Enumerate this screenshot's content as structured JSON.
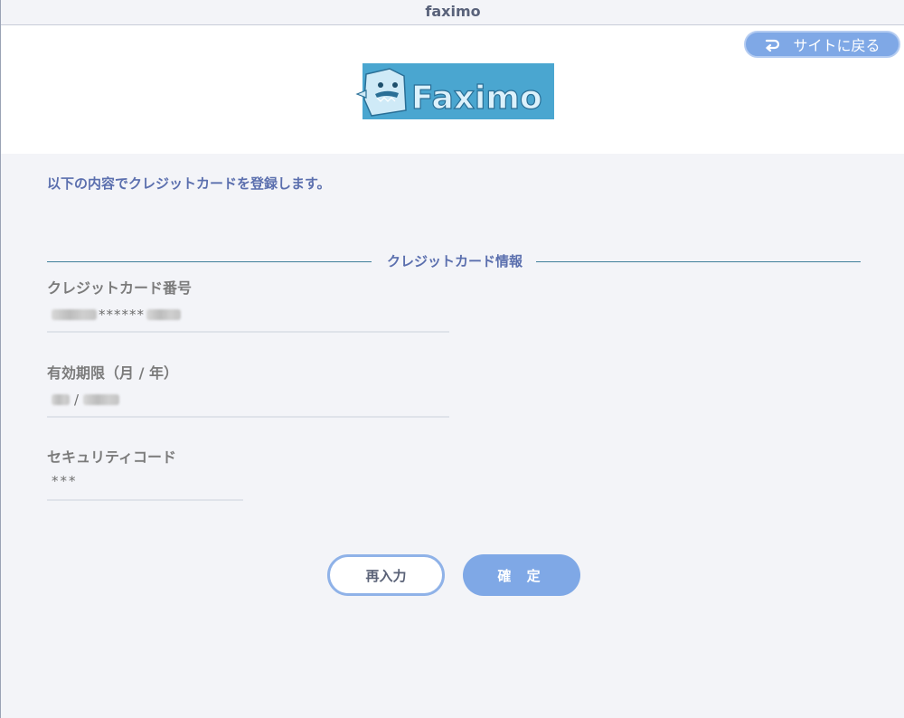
{
  "window": {
    "title": "faximo"
  },
  "header": {
    "back_button_label": "サイトに戻る",
    "logo_text": "Faximo",
    "back_icon": "return-arrow-icon"
  },
  "main": {
    "intro_text": "以下の内容でクレジットカードを登録します。",
    "section_title": "クレジットカード情報",
    "fields": [
      {
        "label": "クレジットカード番号",
        "value_masked": "******"
      },
      {
        "label": "有効期限（月 / 年）",
        "value_separator": "/"
      },
      {
        "label": "セキュリティコード",
        "value_masked": "***"
      }
    ]
  },
  "actions": {
    "reenter_label": "再入力",
    "confirm_label": "確 定"
  },
  "colors": {
    "accent": "#7fa8e6",
    "heading": "#5b6fae",
    "section_line": "#3f7f9a",
    "background": "#f3f4f8"
  }
}
